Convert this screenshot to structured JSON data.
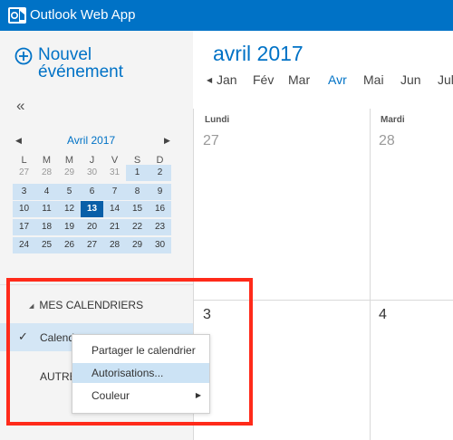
{
  "app": {
    "title": "Outlook Web App"
  },
  "sidebar": {
    "new_event": {
      "line1": "Nouvel",
      "line2": "événement"
    },
    "collapse_label": "«",
    "mini_calendar": {
      "month_label": "Avril 2017",
      "prev_label": "◀",
      "next_label": "▶",
      "weekdays": [
        "L",
        "M",
        "M",
        "J",
        "V",
        "S",
        "D"
      ],
      "weeks": [
        [
          "27",
          "28",
          "29",
          "30",
          "31",
          "1",
          "2"
        ],
        [
          "3",
          "4",
          "5",
          "6",
          "7",
          "8",
          "9"
        ],
        [
          "10",
          "11",
          "12",
          "13",
          "14",
          "15",
          "16"
        ],
        [
          "17",
          "18",
          "19",
          "20",
          "21",
          "22",
          "23"
        ],
        [
          "24",
          "25",
          "26",
          "27",
          "28",
          "29",
          "30"
        ]
      ],
      "today": "13"
    },
    "my_calendars": {
      "label": "MES CALENDRIERS",
      "toggle": "◢"
    },
    "calendar_item": {
      "check": "✓",
      "name": "Calendr"
    },
    "other_label": "AUTRE"
  },
  "main": {
    "month_title": "avril 2017",
    "nav_arrow": "◀",
    "months": [
      "Jan",
      "Fév",
      "Mar",
      "Avr",
      "Mai",
      "Jun",
      "Jul"
    ],
    "active_month": "Avr",
    "day_names": [
      "Lundi",
      "Mardi"
    ],
    "cells": [
      "27",
      "28",
      "3",
      "4"
    ]
  },
  "context_menu": {
    "items": [
      "Partager le calendrier",
      "Autorisations...",
      "Couleur"
    ],
    "selected_index": 1,
    "submenu_arrow": "▶"
  },
  "colors": {
    "brand": "#0072c6",
    "highlight": "#ff2a1a",
    "selection": "#cce3f5",
    "today": "#0a5fa8"
  }
}
